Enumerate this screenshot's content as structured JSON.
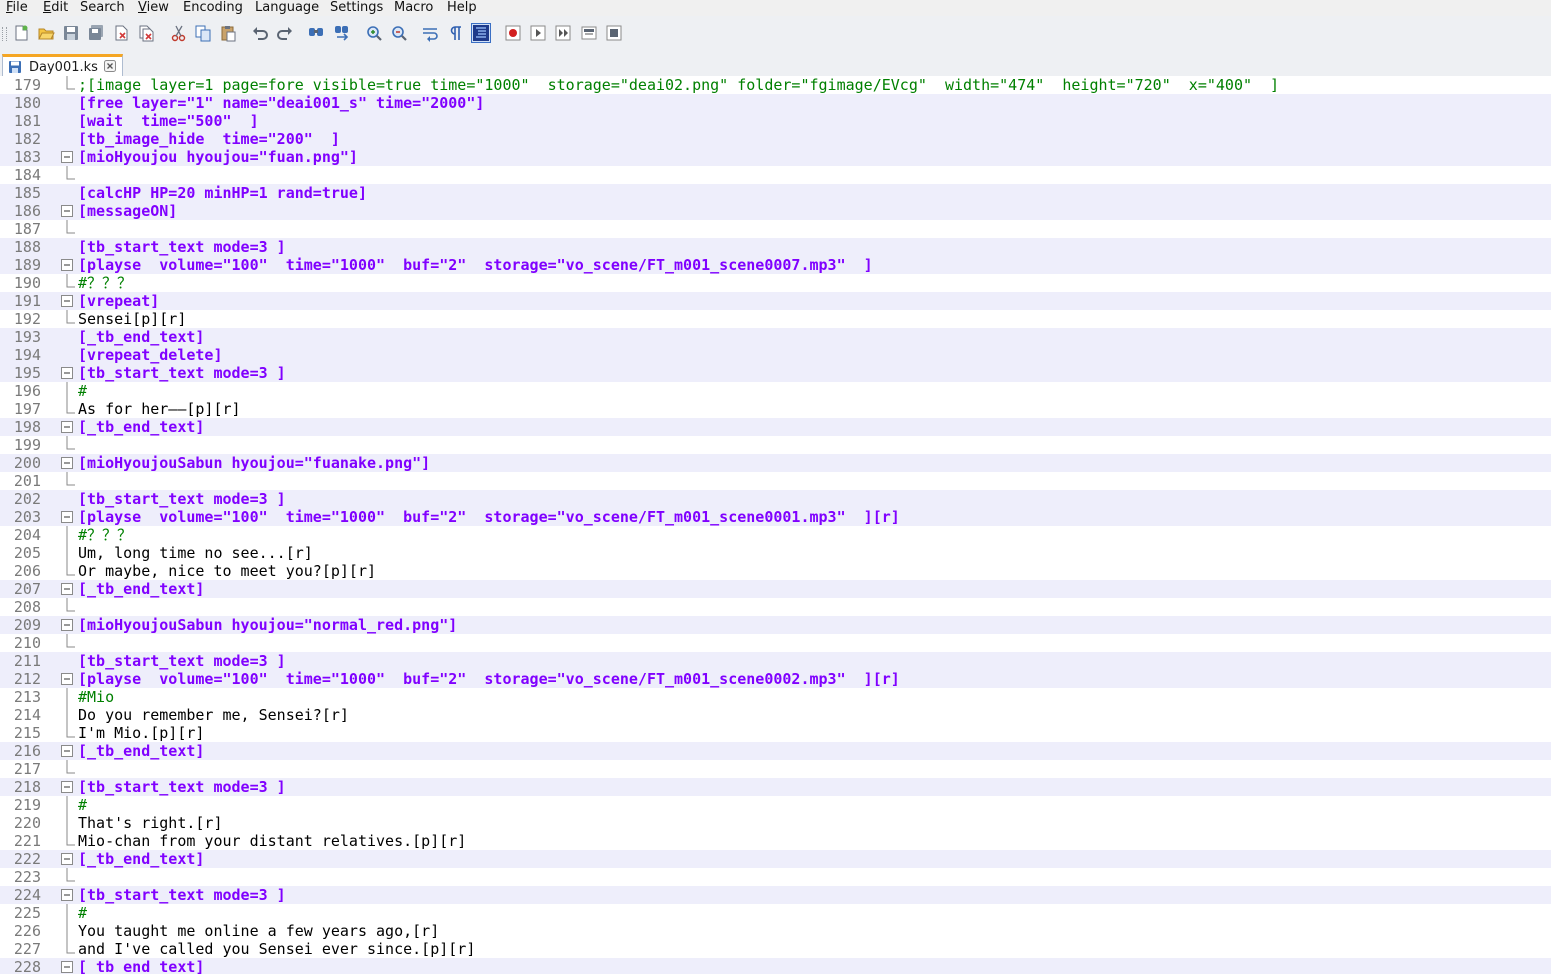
{
  "menu": [
    "File",
    "Edit",
    "Search",
    "View",
    "Encoding",
    "Language",
    "Settings",
    "Macro",
    "Help"
  ],
  "menu_mnemonic": [
    "F",
    "E",
    "",
    "V",
    "",
    "",
    "",
    "",
    ""
  ],
  "toolbar_icons": [
    "new-file-icon",
    "open-file-icon",
    "save-icon",
    "save-all-icon",
    "close-icon",
    "close-all-icon",
    "print-icon",
    "cut-icon",
    "copy-icon",
    "paste-icon",
    "undo-icon",
    "redo-icon",
    "find-icon",
    "replace-icon",
    "zoom-in-icon",
    "zoom-out-icon",
    "word-wrap-icon",
    "show-all-chars-icon",
    "indent-guide-icon",
    "record-macro-icon",
    "stop-macro-icon",
    "play-macro-icon",
    "run-macro-multiple-icon",
    "save-macro-icon"
  ],
  "tab": {
    "label": "Day001.ks"
  },
  "colors": {
    "tag": "#8000ff",
    "comment": "#008000",
    "text": "#000000",
    "highlight": "#eeeefb",
    "line_number": "#7a7a7a"
  },
  "lines": [
    {
      "n": "179",
      "text": ";[image layer=1 page=fore visible=true time=\"1000\"  storage=\"deai02.png\" folder=\"fgimage/EVcg\"  width=\"474\"  height=\"720\"  x=\"400\"  ]",
      "kind": "cmt",
      "fold": "end",
      "hl": false
    },
    {
      "n": "180",
      "text": "[free layer=\"1\" name=\"deai001_s\" time=\"2000\"]",
      "kind": "tag",
      "fold": "none",
      "hl": true
    },
    {
      "n": "181",
      "text": "[wait  time=\"500\"  ]",
      "kind": "tag",
      "fold": "none",
      "hl": true
    },
    {
      "n": "182",
      "text": "[tb_image_hide  time=\"200\"  ]",
      "kind": "tag",
      "fold": "none",
      "hl": true
    },
    {
      "n": "183",
      "text": "[mioHyoujou hyoujou=\"fuan.png\"]",
      "kind": "tag",
      "fold": "start",
      "hl": true
    },
    {
      "n": "184",
      "text": "",
      "kind": "txt",
      "fold": "end",
      "hl": false
    },
    {
      "n": "185",
      "text": "[calcHP HP=20 minHP=1 rand=true]",
      "kind": "tag",
      "fold": "none",
      "hl": true
    },
    {
      "n": "186",
      "text": "[messageON]",
      "kind": "tag",
      "fold": "start",
      "hl": true
    },
    {
      "n": "187",
      "text": "",
      "kind": "txt",
      "fold": "end",
      "hl": false
    },
    {
      "n": "188",
      "text": "[tb_start_text mode=3 ]",
      "kind": "tag",
      "fold": "none",
      "hl": true
    },
    {
      "n": "189",
      "text": "[playse  volume=\"100\"  time=\"1000\"  buf=\"2\"  storage=\"vo_scene/FT_m001_scene0007.mp3\"  ]",
      "kind": "tag",
      "fold": "start",
      "hl": true
    },
    {
      "n": "190",
      "text": "#？？？",
      "kind": "hdr",
      "fold": "end",
      "hl": false
    },
    {
      "n": "191",
      "text": "[vrepeat]",
      "kind": "tag",
      "fold": "start",
      "hl": true
    },
    {
      "n": "192",
      "text": "Sensei[p][r]",
      "kind": "txt",
      "fold": "end",
      "hl": false
    },
    {
      "n": "193",
      "text": "[_tb_end_text]",
      "kind": "tag",
      "fold": "none",
      "hl": true
    },
    {
      "n": "194",
      "text": "[vrepeat_delete]",
      "kind": "tag",
      "fold": "none",
      "hl": true
    },
    {
      "n": "195",
      "text": "[tb_start_text mode=3 ]",
      "kind": "tag",
      "fold": "start",
      "hl": true
    },
    {
      "n": "196",
      "text": "#",
      "kind": "hdr",
      "fold": "mid",
      "hl": false
    },
    {
      "n": "197",
      "text": "As for her——[p][r]",
      "kind": "txt",
      "fold": "end",
      "hl": false
    },
    {
      "n": "198",
      "text": "[_tb_end_text]",
      "kind": "tag",
      "fold": "start",
      "hl": true
    },
    {
      "n": "199",
      "text": "",
      "kind": "txt",
      "fold": "end",
      "hl": false
    },
    {
      "n": "200",
      "text": "[mioHyoujouSabun hyoujou=\"fuanake.png\"]",
      "kind": "tag",
      "fold": "start",
      "hl": true
    },
    {
      "n": "201",
      "text": "",
      "kind": "txt",
      "fold": "end",
      "hl": false
    },
    {
      "n": "202",
      "text": "[tb_start_text mode=3 ]",
      "kind": "tag",
      "fold": "none",
      "hl": true
    },
    {
      "n": "203",
      "text": "[playse  volume=\"100\"  time=\"1000\"  buf=\"2\"  storage=\"vo_scene/FT_m001_scene0001.mp3\"  ][r]",
      "kind": "tag",
      "fold": "start",
      "hl": true
    },
    {
      "n": "204",
      "text": "#？？？",
      "kind": "hdr",
      "fold": "mid",
      "hl": false
    },
    {
      "n": "205",
      "text": "Um, long time no see...[r]",
      "kind": "txt",
      "fold": "mid",
      "hl": false
    },
    {
      "n": "206",
      "text": "Or maybe, nice to meet you?[p][r]",
      "kind": "txt",
      "fold": "end",
      "hl": false
    },
    {
      "n": "207",
      "text": "[_tb_end_text]",
      "kind": "tag",
      "fold": "start",
      "hl": true
    },
    {
      "n": "208",
      "text": "",
      "kind": "txt",
      "fold": "end",
      "hl": false
    },
    {
      "n": "209",
      "text": "[mioHyoujouSabun hyoujou=\"normal_red.png\"]",
      "kind": "tag",
      "fold": "start",
      "hl": true
    },
    {
      "n": "210",
      "text": "",
      "kind": "txt",
      "fold": "end",
      "hl": false
    },
    {
      "n": "211",
      "text": "[tb_start_text mode=3 ]",
      "kind": "tag",
      "fold": "none",
      "hl": true
    },
    {
      "n": "212",
      "text": "[playse  volume=\"100\"  time=\"1000\"  buf=\"2\"  storage=\"vo_scene/FT_m001_scene0002.mp3\"  ][r]",
      "kind": "tag",
      "fold": "start",
      "hl": true
    },
    {
      "n": "213",
      "text": "#Mio",
      "kind": "hdr",
      "fold": "mid",
      "hl": false
    },
    {
      "n": "214",
      "text": "Do you remember me, Sensei?[r]",
      "kind": "txt",
      "fold": "mid",
      "hl": false
    },
    {
      "n": "215",
      "text": "I'm Mio.[p][r]",
      "kind": "txt",
      "fold": "end",
      "hl": false
    },
    {
      "n": "216",
      "text": "[_tb_end_text]",
      "kind": "tag",
      "fold": "start",
      "hl": true
    },
    {
      "n": "217",
      "text": "",
      "kind": "txt",
      "fold": "end",
      "hl": false
    },
    {
      "n": "218",
      "text": "[tb_start_text mode=3 ]",
      "kind": "tag",
      "fold": "start",
      "hl": true
    },
    {
      "n": "219",
      "text": "#",
      "kind": "hdr",
      "fold": "mid",
      "hl": false
    },
    {
      "n": "220",
      "text": "That's right.[r]",
      "kind": "txt",
      "fold": "mid",
      "hl": false
    },
    {
      "n": "221",
      "text": "Mio-chan from your distant relatives.[p][r]",
      "kind": "txt",
      "fold": "end",
      "hl": false
    },
    {
      "n": "222",
      "text": "[_tb_end_text]",
      "kind": "tag",
      "fold": "start",
      "hl": true
    },
    {
      "n": "223",
      "text": "",
      "kind": "txt",
      "fold": "end",
      "hl": false
    },
    {
      "n": "224",
      "text": "[tb_start_text mode=3 ]",
      "kind": "tag",
      "fold": "start",
      "hl": true
    },
    {
      "n": "225",
      "text": "#",
      "kind": "hdr",
      "fold": "mid",
      "hl": false
    },
    {
      "n": "226",
      "text": "You taught me online a few years ago,[r]",
      "kind": "txt",
      "fold": "mid",
      "hl": false
    },
    {
      "n": "227",
      "text": "and I've called you Sensei ever since.[p][r]",
      "kind": "txt",
      "fold": "end",
      "hl": false
    },
    {
      "n": "228",
      "text": "[_tb_end_text]",
      "kind": "tag",
      "fold": "start",
      "hl": true
    }
  ]
}
